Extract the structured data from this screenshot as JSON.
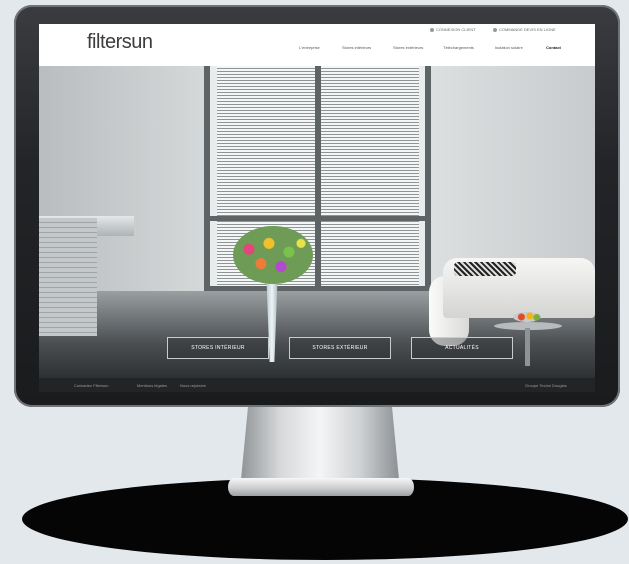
{
  "site": {
    "logo": "filtersun"
  },
  "header": {
    "utility_links": [
      "CONNEXION CLIENT",
      "COMMANDE DEVIS EN LIGNE"
    ],
    "nav": [
      "L'entreprise",
      "Stores intérieurs",
      "Stores extérieurs",
      "Téléchargements",
      "Isolation solaire",
      "Contact"
    ],
    "active_nav": "Contact"
  },
  "hero": {
    "buttons": [
      "STORES INTÉRIEUR",
      "STORES EXTÉRIEUR",
      "ACTUALITÉS"
    ]
  },
  "footer": {
    "links": [
      "Contactez Filtersun",
      "Mentions légales",
      "Nous rejoindre"
    ],
    "right": "Groupe Techni Douglas"
  },
  "colors": {
    "background": "#e3e8ed",
    "bezel": "#222427",
    "header": "#ffffff",
    "footer": "#222426"
  }
}
